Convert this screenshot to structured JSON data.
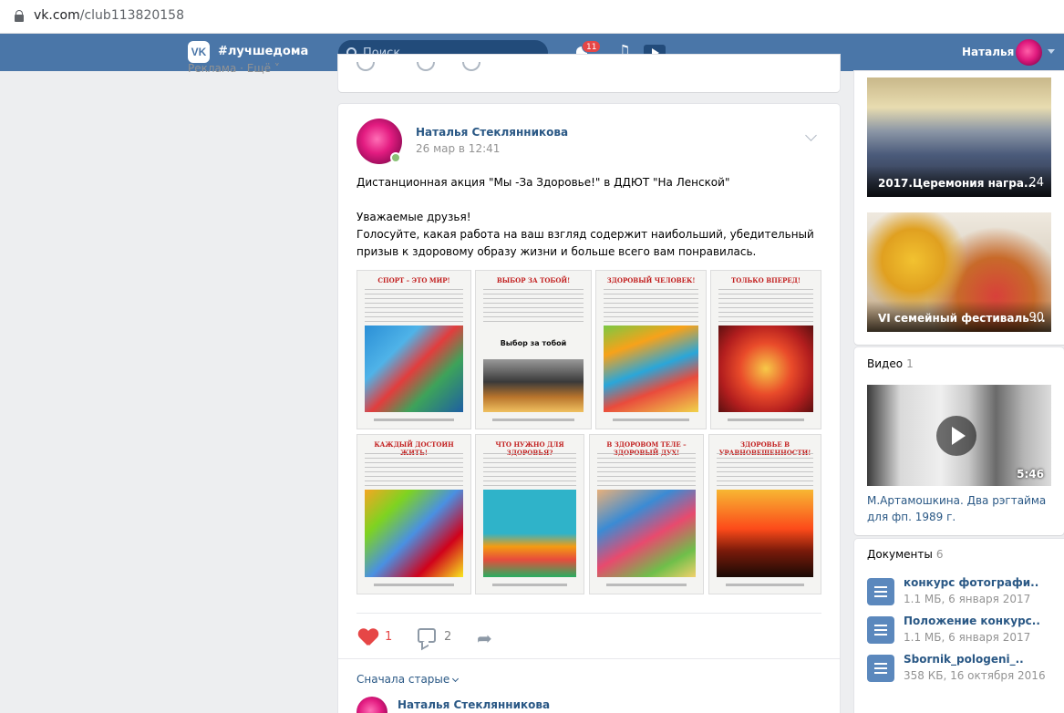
{
  "browser": {
    "url_host": "vk.com",
    "url_path": "/club113820158"
  },
  "header": {
    "logo": "VK",
    "hashtag": "#лучшедома",
    "search_placeholder": "Поиск",
    "notifications_count": "11",
    "user_name": "Наталья"
  },
  "left": {
    "links": "Реклама · Ещё ˅"
  },
  "post": {
    "author": "Наталья Стеклянникова",
    "date": "26 мар в 12:41",
    "text_line1": "Дистанционная акция \"Мы -За Здоровье!\" в ДДЮТ \"На Ленской\"",
    "text_line2": "Уважаемые друзья!",
    "text_line3": "Голосуйте, какая работа на ваш взгляд содержит наибольший, убедительный призыв к здоровому образу жизни и больше всего вам понравилась.",
    "images": [
      {
        "title": "СПОРТ – ЭТО МИР!",
        "caption": ""
      },
      {
        "title": "ВЫБОР ЗА ТОБОЙ!",
        "caption": "Выбор за тобой"
      },
      {
        "title": "ЗДОРОВЫЙ ЧЕЛОВЕК!",
        "caption": ""
      },
      {
        "title": "ТОЛЬКО ВПЕРЕД!",
        "caption": ""
      },
      {
        "title": "КАЖДЫЙ ДОСТОИН ЖИТЬ!",
        "caption": ""
      },
      {
        "title": "ЧТО НУЖНО ДЛЯ ЗДОРОВЬЯ?",
        "caption": ""
      },
      {
        "title": "В ЗДОРОВОМ ТЕЛЕ – ЗДОРОВЫЙ ДУХ!",
        "caption": ""
      },
      {
        "title": "ЗДОРОВЬЕ В УРАВНОВЕШЕННОСТИ!",
        "caption": ""
      }
    ],
    "likes": "1",
    "comments": "2",
    "sort_label": "Сначала старые",
    "comment_author": "Наталья Стеклянникова"
  },
  "albums": [
    {
      "title": "2017.Церемония награ...",
      "count": "24"
    },
    {
      "title": "VI семейный фестиваль ...",
      "count": "90"
    }
  ],
  "video": {
    "heading": "Видео",
    "count": "1",
    "duration": "5:46",
    "title": "М.Артамошкина. Два рэгтайма для фп. 1989 г."
  },
  "docs": {
    "heading": "Документы",
    "count": "6",
    "items": [
      {
        "name": "конкурс фотографи..",
        "meta": "1.1 МБ, 6 января 2017"
      },
      {
        "name": "Положение конкурс..",
        "meta": "1.1 МБ, 6 января 2017"
      },
      {
        "name": "Sbornik_pologeni_..",
        "meta": "358 КБ, 16 октября 2016"
      }
    ]
  },
  "colors": {
    "header_bg": "#4a76a8",
    "link": "#2a5885",
    "like": "#e64646"
  }
}
